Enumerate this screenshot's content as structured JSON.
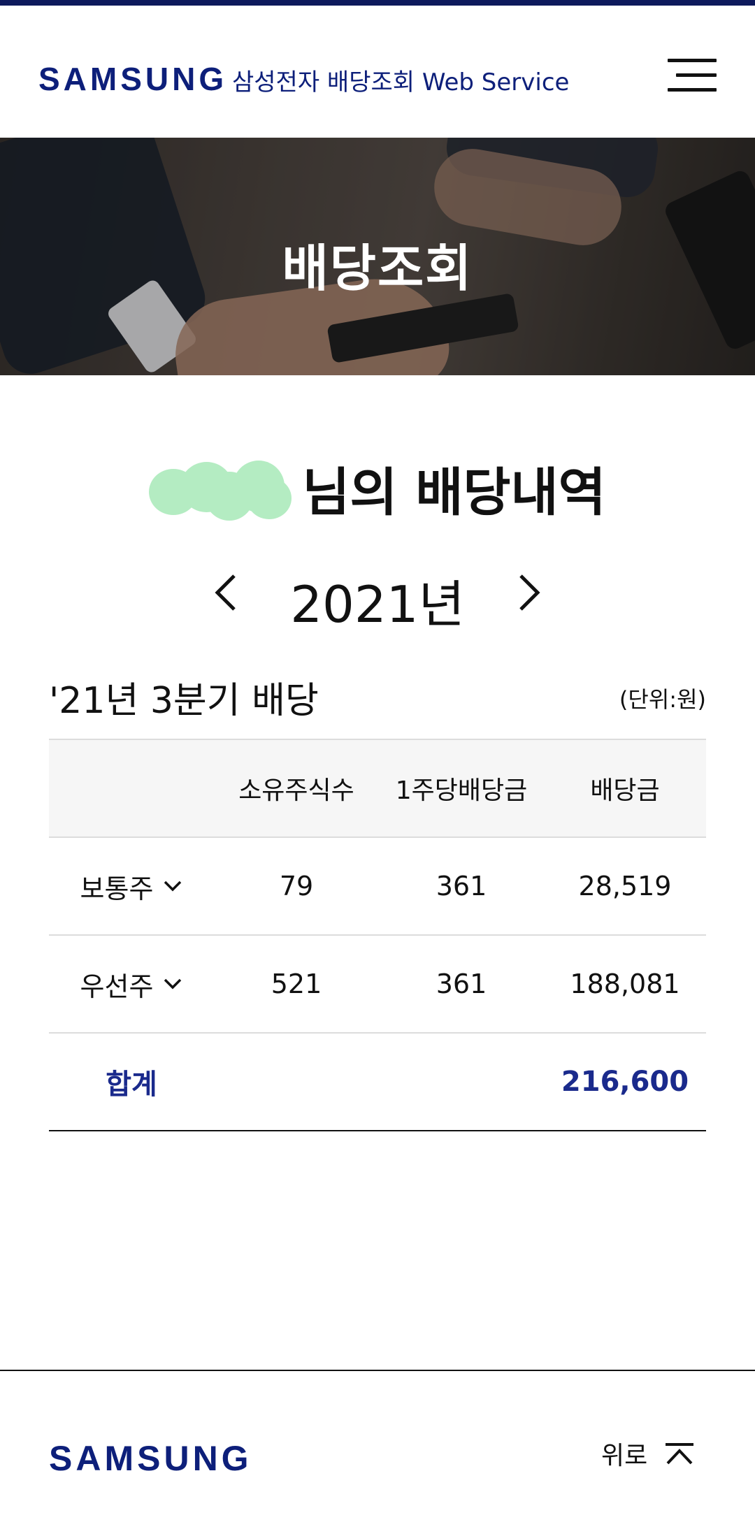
{
  "header": {
    "logo": "SAMSUNG",
    "subtitle": "삼성전자 배당조회 Web Service",
    "menu_icon": "hamburger-menu-icon"
  },
  "hero": {
    "title": "배당조회"
  },
  "owner": {
    "suffix": "님의 배당내역"
  },
  "year_nav": {
    "year": "2021년",
    "prev_icon": "chevron-left-icon",
    "next_icon": "chevron-right-icon"
  },
  "section": {
    "title": "'21년 3분기 배당",
    "unit": "(단위:원)"
  },
  "table": {
    "headers": [
      "",
      "소유주식수",
      "1주당배당금",
      "배당금"
    ],
    "rows": [
      {
        "label": "보통주",
        "shares": "79",
        "per_share": "361",
        "dividend": "28,519"
      },
      {
        "label": "우선주",
        "shares": "521",
        "per_share": "361",
        "dividend": "188,081"
      }
    ],
    "total": {
      "label": "합계",
      "dividend": "216,600"
    }
  },
  "colors": {
    "brand": "#0d1f7a",
    "total_text": "#1a2a8c",
    "redaction": "#b4ecc2"
  },
  "footer": {
    "logo": "SAMSUNG",
    "to_top_label": "위로",
    "to_top_icon": "chevron-up-icon"
  }
}
